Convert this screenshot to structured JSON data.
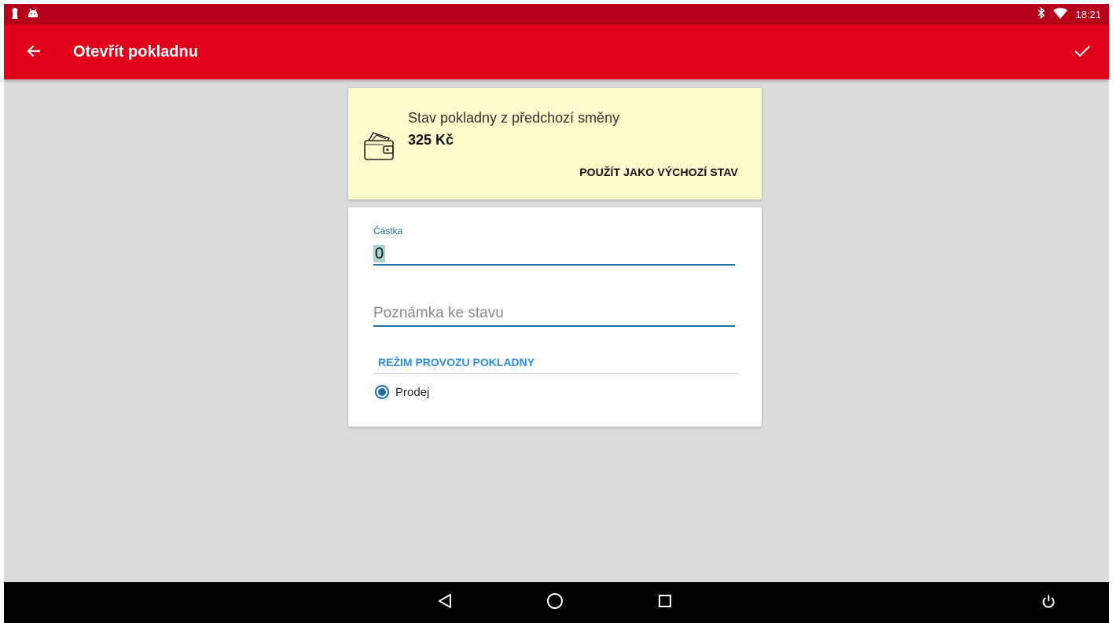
{
  "status_bar": {
    "time": "18:21",
    "left_icons": [
      "keyhole-icon",
      "android-icon"
    ],
    "right_icons": [
      "bluetooth-icon",
      "wifi-icon"
    ]
  },
  "app_bar": {
    "title": "Otevřít pokladnu",
    "back_icon": "arrow-left-icon",
    "confirm_icon": "checkmark-icon"
  },
  "previous_shift": {
    "label": "Stav pokladny z předchozí směny",
    "amount": "325 Kč",
    "use_button": "POUŽÍT JAKO VÝCHOZÍ STAV",
    "icon": "wallet-icon"
  },
  "form": {
    "amount_label": "Částka",
    "amount_value": "0",
    "note_placeholder": "Poznámka ke stavu",
    "mode_header": "REŽIM PROVOZU POKLADNY",
    "mode_options": [
      {
        "label": "Prodej",
        "selected": true
      }
    ]
  },
  "nav_bar": {
    "buttons": [
      "back-triangle-icon",
      "home-circle-icon",
      "recents-square-icon",
      "power-icon"
    ]
  },
  "colors": {
    "status_bar": "#b5001b",
    "app_bar": "#e0001a",
    "accent": "#1e6fb0",
    "prev_card_bg": "#fbfbcc",
    "background": "#dcdcdc"
  }
}
